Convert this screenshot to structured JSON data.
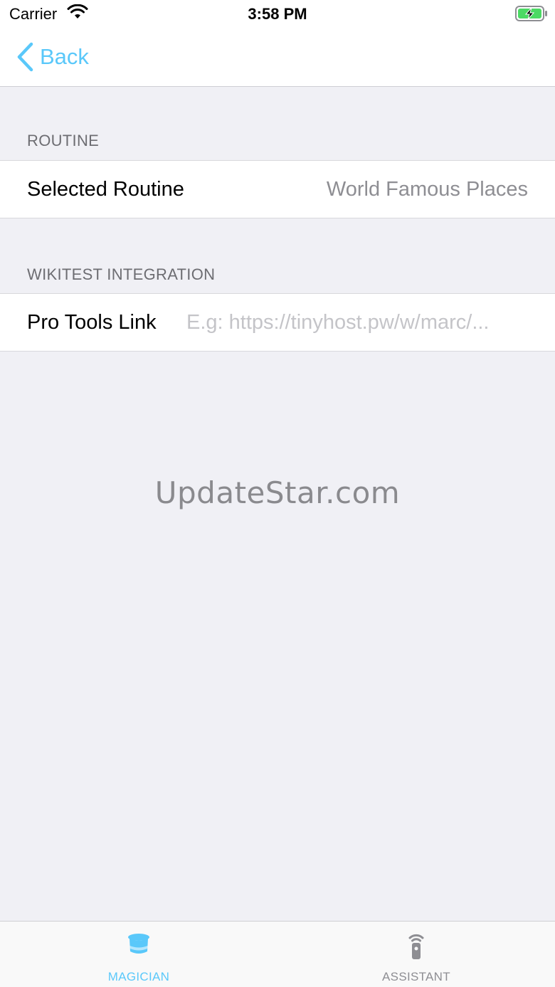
{
  "status_bar": {
    "carrier": "Carrier",
    "time": "3:58 PM",
    "icons": [
      "wifi-icon",
      "battery-charging-icon"
    ]
  },
  "nav": {
    "back_label": "Back",
    "accent_color": "#5ac8fa"
  },
  "sections": {
    "routine": {
      "header": "ROUTINE",
      "row_label": "Selected Routine",
      "row_value": "World Famous Places"
    },
    "wikitest": {
      "header": "WIKITEST INTEGRATION",
      "row_label": "Pro Tools Link",
      "input_value": "",
      "input_placeholder": "E.g: https://tinyhost.pw/w/marc/..."
    }
  },
  "watermark": "UpdateStar.com",
  "tab_bar": {
    "tabs": [
      {
        "label": "MAGICIAN",
        "icon": "magician-hat-icon",
        "selected": true
      },
      {
        "label": "ASSISTANT",
        "icon": "remote-signal-icon",
        "selected": false
      }
    ],
    "selected_color": "#5ac8fa",
    "unselected_color": "#8e8e93"
  }
}
